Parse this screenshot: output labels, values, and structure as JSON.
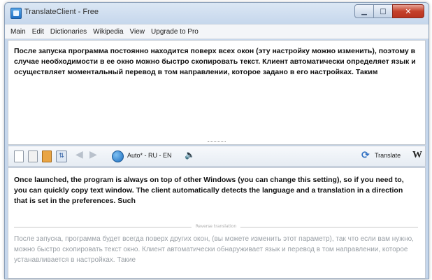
{
  "window": {
    "title": "TranslateClient - Free",
    "controls": {
      "minimize": "▁",
      "maximize": "□",
      "close": "✕"
    }
  },
  "menu": [
    "Main",
    "Edit",
    "Dictionaries",
    "Wikipedia",
    "View",
    "Upgrade to Pro"
  ],
  "source": {
    "text": "После запуска программа постоянно находится поверх всех окон (эту настройку можно изменить), поэтому в случае необходимости в ее окно можно быстро скопировать текст. Клиент автоматически определяет язык и осуществляет моментальный перевод в том направлении, которое задано в его настройках. Таким"
  },
  "toolbar": {
    "language_pair": "Auto* - RU - EN",
    "translate_label": "Translate",
    "wiki_label": "W",
    "icons": [
      "new-document-icon",
      "copy-icon",
      "paste-icon",
      "swap-icon",
      "back-arrow-icon",
      "forward-arrow-icon",
      "globe-icon",
      "speaker-icon",
      "refresh-icon",
      "wikipedia-icon"
    ]
  },
  "result": {
    "text": "Once launched, the program is always on top of other Windows (you can change this setting), so if you need to, you can quickly copy text window. The client automatically detects the language and a translation in a direction that is set in the preferences. Such",
    "divider_label": "Reverse translation",
    "alt_text": "После запуска, программа будет всегда поверх других окон, (вы можете изменить этот параметр), так что если вам нужно, можно быстро скопировать текст окно. Клиент автоматически обнаруживает язык и перевод в том направлении, которое устанавливается в настройках. Такие"
  }
}
